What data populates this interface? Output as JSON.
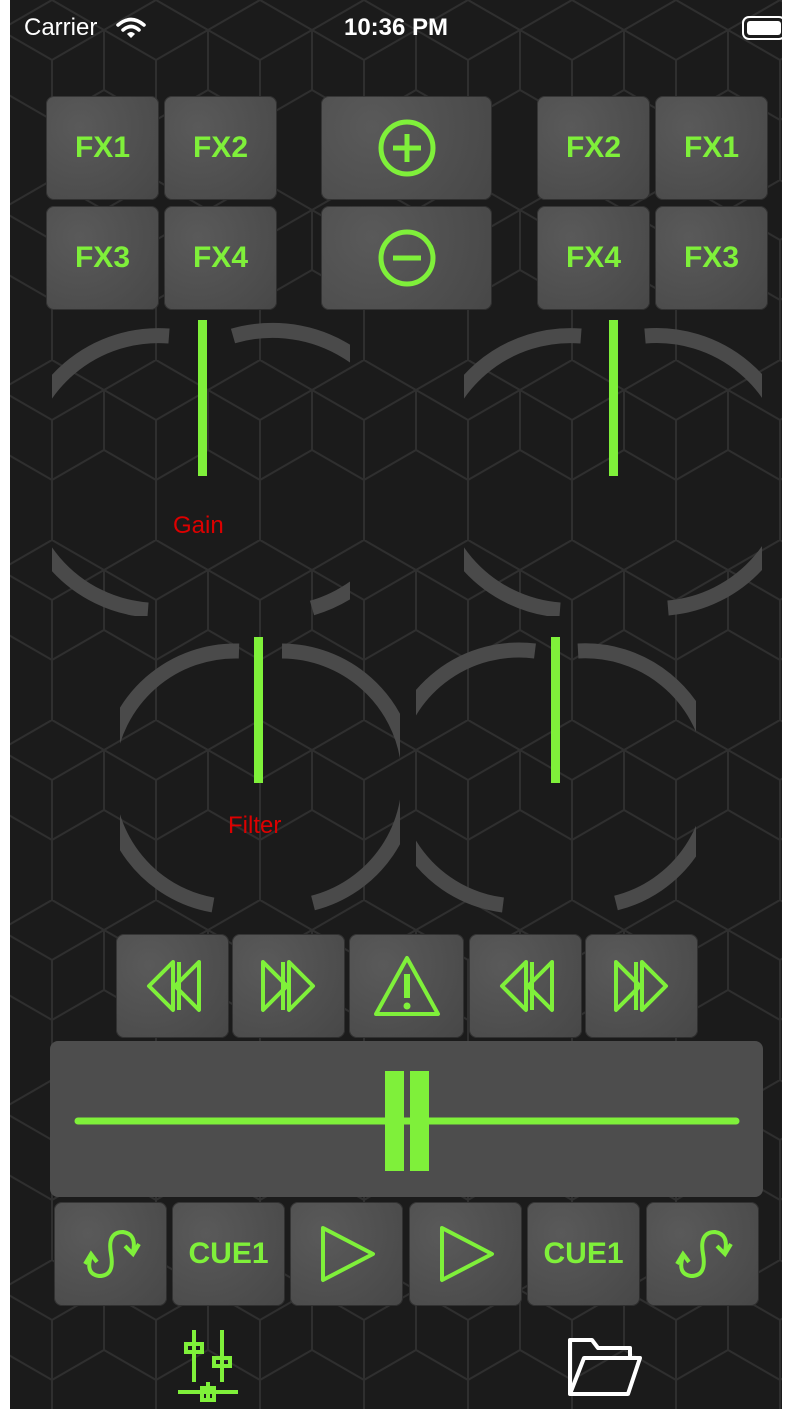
{
  "status_bar": {
    "carrier": "Carrier",
    "time": "10:36 PM"
  },
  "colors": {
    "accent": "#7ff03a",
    "label_red": "#dd0000",
    "pad_bg": "#4d4d4d",
    "knob_track": "#4a4a4a"
  },
  "deck_left": {
    "fx_buttons": [
      "FX1",
      "FX2",
      "FX3",
      "FX4"
    ],
    "gain_label": "Gain",
    "filter_label": "Filter"
  },
  "deck_right": {
    "fx_buttons": [
      "FX2",
      "FX1",
      "FX4",
      "FX3"
    ]
  },
  "center_controls": {
    "add_icon": "plus-circle-icon",
    "remove_icon": "minus-circle-icon"
  },
  "transport_row": [
    "rewind-icon",
    "fast-forward-icon",
    "warning-icon",
    "rewind-icon",
    "fast-forward-icon"
  ],
  "crossfader": {
    "position": 0.5
  },
  "bottom_row": {
    "left_cue": "CUE1",
    "right_cue": "CUE1",
    "loop_icon": "loop-icon",
    "play_icon": "play-icon"
  },
  "tab_bar": {
    "mixer_icon": "mixer-sliders-icon",
    "files_icon": "folder-icon",
    "active_tab": "mixer"
  }
}
